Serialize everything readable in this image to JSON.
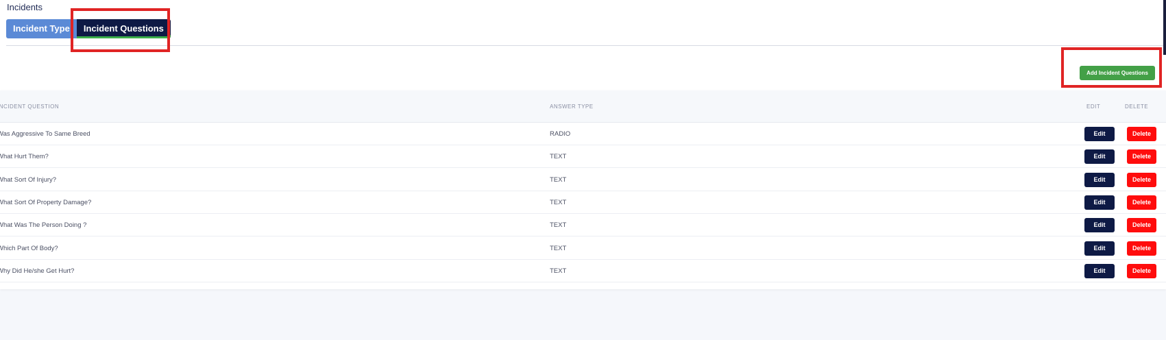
{
  "page": {
    "title": "Incidents"
  },
  "tabs": [
    {
      "label": "Incident Type",
      "active": false
    },
    {
      "label": "Incident Questions",
      "active": true
    }
  ],
  "actions": {
    "add_label": "Add Incident Questions"
  },
  "table": {
    "headers": {
      "question": "INCIDENT QUESTION",
      "answer_type": "ANSWER TYPE",
      "edit": "EDIT",
      "delete": "DELETE"
    },
    "rows": [
      {
        "question": "Was Aggressive To Same Breed",
        "answer_type": "RADIO",
        "edit": "Edit",
        "delete": "Delete"
      },
      {
        "question": "What Hurt Them?",
        "answer_type": "TEXT",
        "edit": "Edit",
        "delete": "Delete"
      },
      {
        "question": "What Sort Of Injury?",
        "answer_type": "TEXT",
        "edit": "Edit",
        "delete": "Delete"
      },
      {
        "question": "What Sort Of Property Damage?",
        "answer_type": "TEXT",
        "edit": "Edit",
        "delete": "Delete"
      },
      {
        "question": "What Was The Person Doing ?",
        "answer_type": "TEXT",
        "edit": "Edit",
        "delete": "Delete"
      },
      {
        "question": "Which Part Of Body?",
        "answer_type": "TEXT",
        "edit": "Edit",
        "delete": "Delete"
      },
      {
        "question": "Why Did He/she Get Hurt?",
        "answer_type": "TEXT",
        "edit": "Edit",
        "delete": "Delete"
      }
    ]
  },
  "colors": {
    "tab_inactive": "#5b8ad6",
    "tab_active": "#0e1a45",
    "add_button": "#43a047",
    "edit_button": "#0e1a45",
    "delete_button": "#ff0d0d",
    "highlight": "#e02424"
  }
}
